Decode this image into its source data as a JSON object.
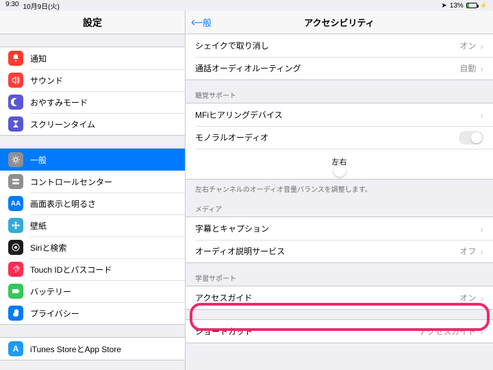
{
  "statusbar": {
    "time": "9:30",
    "date": "10月9日(火)",
    "battery": "13%"
  },
  "leftTitle": "設定",
  "sidebar": {
    "g1": [
      {
        "label": "通知",
        "color": "ic-red",
        "icon": "bell"
      },
      {
        "label": "サウンド",
        "color": "ic-red2",
        "icon": "speaker"
      },
      {
        "label": "おやすみモード",
        "color": "ic-purple",
        "icon": "moon"
      },
      {
        "label": "スクリーンタイム",
        "color": "ic-purple2",
        "icon": "hourglass"
      }
    ],
    "g2": [
      {
        "label": "一般",
        "color": "ic-gray",
        "icon": "gear",
        "selected": true
      },
      {
        "label": "コントロールセンター",
        "color": "ic-gray2",
        "icon": "switches"
      },
      {
        "label": "画面表示と明るさ",
        "color": "ic-blue",
        "icon": "AA"
      },
      {
        "label": "壁紙",
        "color": "ic-cyan",
        "icon": "flower"
      },
      {
        "label": "Siriと検索",
        "color": "ic-black",
        "icon": "siri"
      },
      {
        "label": "Touch IDとパスコード",
        "color": "ic-red3",
        "icon": "finger"
      },
      {
        "label": "バッテリー",
        "color": "ic-green",
        "icon": "batt"
      },
      {
        "label": "プライバシー",
        "color": "ic-blue3",
        "icon": "hand"
      }
    ],
    "g3": [
      {
        "label": "iTunes StoreとApp Store",
        "color": "ic-blue4",
        "icon": "A"
      }
    ]
  },
  "detail": {
    "back": "一般",
    "title": "アクセシビリティ",
    "interaction": [
      {
        "label": "シェイクで取り消し",
        "value": "オン"
      },
      {
        "label": "通話オーディオルーティング",
        "value": "自動"
      }
    ],
    "hearingHeader": "聴覚サポート",
    "hearing": {
      "mfi": "MFiヒアリングデバイス",
      "mono": "モノラルオーディオ",
      "left": "左",
      "right": "右",
      "footer": "左右チャンネルのオーディオ音量バランスを調整します。"
    },
    "mediaHeader": "メディア",
    "media": [
      {
        "label": "字幕とキャプション",
        "value": ""
      },
      {
        "label": "オーディオ説明サービス",
        "value": "オフ"
      }
    ],
    "learningHeader": "学習サポート",
    "learning": {
      "label": "アクセスガイド",
      "value": "オン"
    },
    "shortcut": {
      "label": "ショートカット",
      "value": "アクセスガイド"
    }
  }
}
